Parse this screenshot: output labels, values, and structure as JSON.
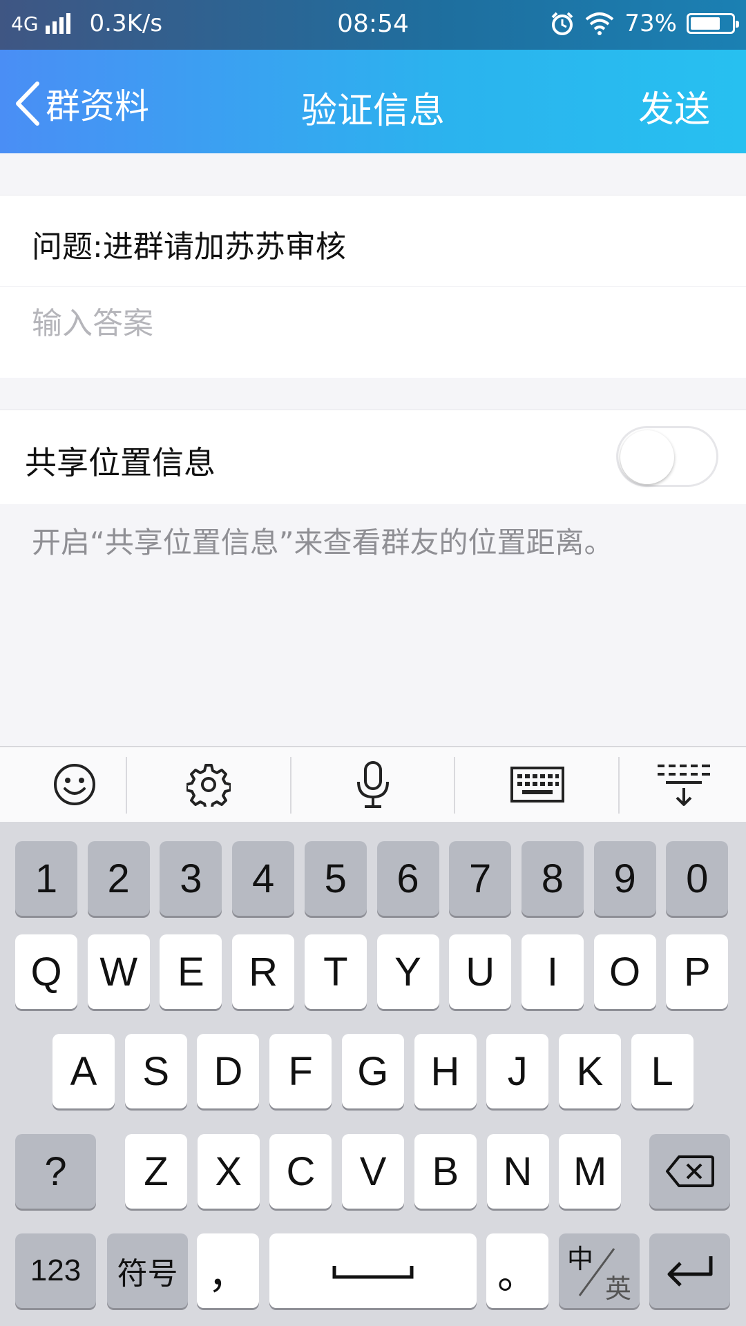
{
  "status_bar": {
    "network": "4G",
    "speed": "0.3K/s",
    "time": "08:54",
    "battery": "73%",
    "battery_level": 0.73
  },
  "nav": {
    "back_label": "群资料",
    "title": "验证信息",
    "send_label": "发送"
  },
  "form": {
    "question": "问题:进群请加苏苏审核",
    "answer_placeholder": "输入答案",
    "answer_value": ""
  },
  "location": {
    "label": "共享位置信息",
    "enabled": false,
    "hint": "开启“共享位置信息”来查看群友的位置距离。"
  },
  "keyboard": {
    "toolbar": [
      "emoji-icon",
      "settings-icon",
      "microphone-icon",
      "keyboard-icon",
      "collapse-keyboard-icon"
    ],
    "number_row": [
      "1",
      "2",
      "3",
      "4",
      "5",
      "6",
      "7",
      "8",
      "9",
      "0"
    ],
    "row1": [
      "Q",
      "W",
      "E",
      "R",
      "T",
      "Y",
      "U",
      "I",
      "O",
      "P"
    ],
    "row2": [
      "A",
      "S",
      "D",
      "F",
      "G",
      "H",
      "J",
      "K",
      "L"
    ],
    "row3": [
      "Z",
      "X",
      "C",
      "V",
      "B",
      "N",
      "M"
    ],
    "question_key": "?",
    "num_key": "123",
    "symbol_key": "符号",
    "comma_key": "，",
    "period_key": "。",
    "lang_key_top": "中",
    "lang_key_bottom": "英"
  }
}
